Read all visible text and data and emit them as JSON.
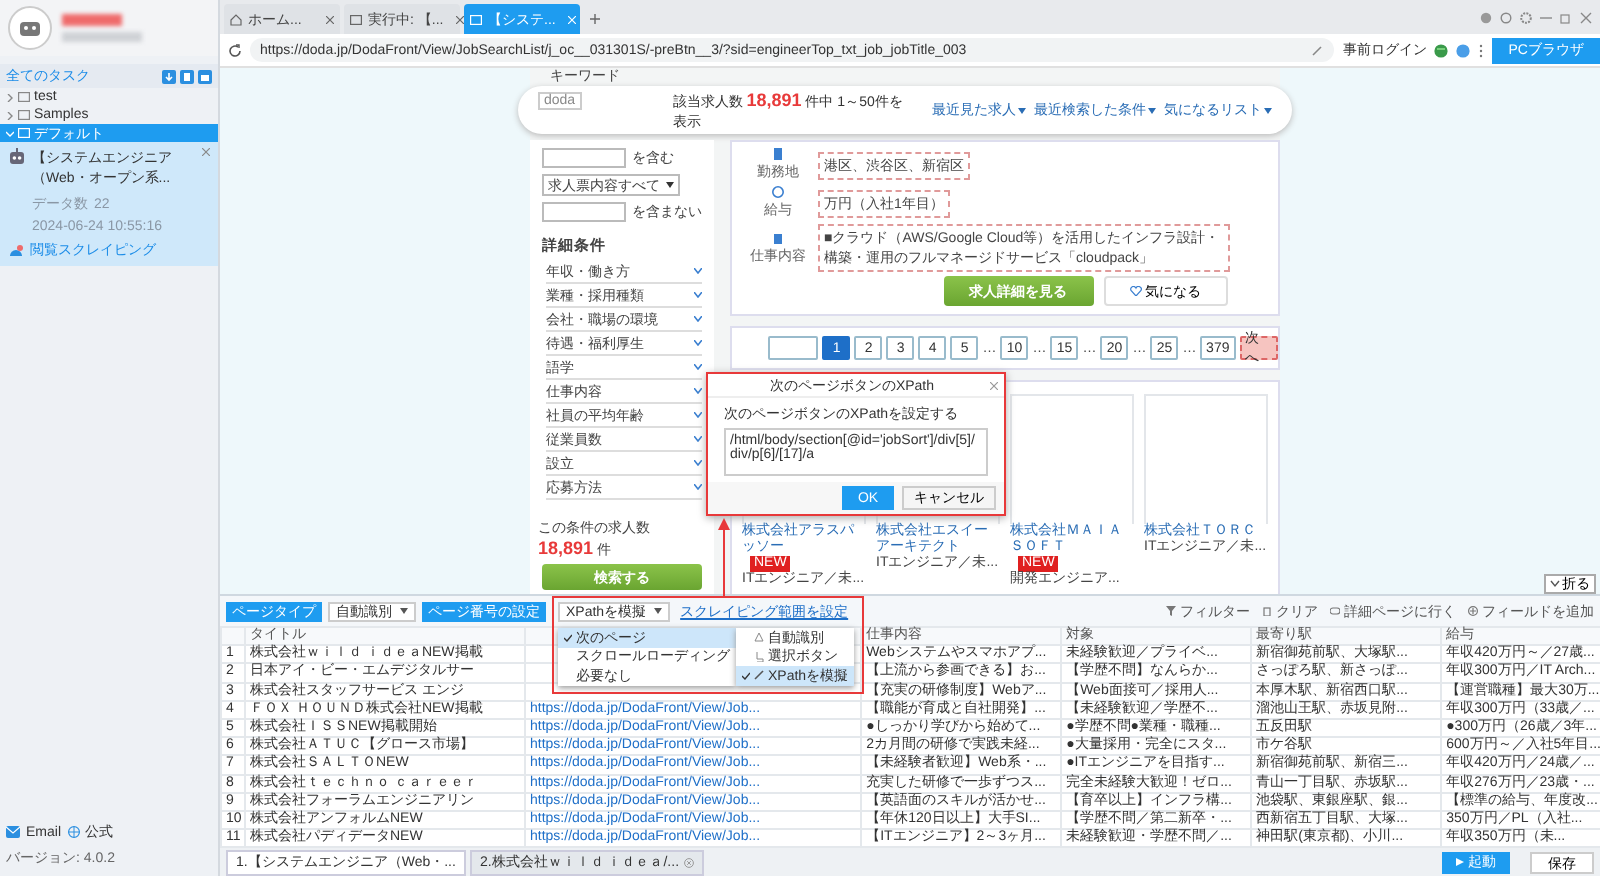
{
  "sidebar": {
    "header": "全てのタスク",
    "groups": [
      {
        "label": "test",
        "expanded": false,
        "selected": false
      },
      {
        "label": "Samples",
        "expanded": false,
        "selected": false
      },
      {
        "label": "デフォルト",
        "expanded": true,
        "selected": true
      }
    ],
    "task": {
      "title": "【システムエンジニア（Web・オープン系...",
      "data_label": "データ数",
      "data_count": "22",
      "time": "2024-06-24 10:55:16",
      "action": "閲覧スクレイピング"
    },
    "footer": {
      "links": [
        "Email",
        "公式"
      ],
      "version": "バージョン: 4.0.2"
    }
  },
  "browser": {
    "tabs": [
      {
        "label": "ホーム...",
        "selected": false
      },
      {
        "label": "実行中: 【...",
        "selected": false
      },
      {
        "label": "【システ...",
        "selected": true
      }
    ],
    "url": "https://doda.jp/DodaFront/View/JobSearchList/j_oc__031301S/-preBtn__3/?sid=engineerTop_txt_job_jobTitle_003",
    "login": "事前ログイン",
    "mode_button": "PCブラウザ"
  },
  "page": {
    "keyword_heading": "キーワード",
    "logo_alt": "doda",
    "count_prefix": "該当求人数",
    "count": "18,891",
    "count_suffix": "件中 1～50件を表示",
    "nav": [
      "最近見た求人",
      "最近検索した条件",
      "気になるリスト"
    ],
    "include": "を含む",
    "scope_select": "求人票内容すべて",
    "exclude": "を含まない",
    "details_heading": "詳細条件",
    "filters": [
      "年収・働き方",
      "業種・採用種類",
      "会社・職場の環境",
      "待遇・福利厚生",
      "語学",
      "仕事内容",
      "社員の平均年齢",
      "従業員数",
      "設立",
      "応募方法"
    ],
    "total_prefix": "この条件の求人数",
    "total": "18,891",
    "total_suffix": "件",
    "search_button": "検索する",
    "details": [
      {
        "label": "勤務地",
        "value": "港区、渋谷区、新宿区"
      },
      {
        "label": "給与",
        "value": "万円（入社1年目）"
      },
      {
        "label": "仕事内容",
        "value": "■クラウド（AWS/Google Cloud等）を活用したインフラ設計・構築・運用のフルマネージドサービス「cloudpack」"
      }
    ],
    "detail_button": "求人詳細を見る",
    "favorite_button": "気になる",
    "pagination": [
      {
        "kind": "prev",
        "selected": false
      },
      {
        "kind": "page",
        "label": "1",
        "selected": true
      },
      {
        "kind": "page",
        "label": "2",
        "selected": false
      },
      {
        "kind": "page",
        "label": "3",
        "selected": false
      },
      {
        "kind": "page",
        "label": "4",
        "selected": false
      },
      {
        "kind": "page",
        "label": "5",
        "selected": false
      },
      {
        "kind": "gap",
        "label": "…"
      },
      {
        "kind": "page",
        "label": "10",
        "selected": false
      },
      {
        "kind": "gap",
        "label": "…"
      },
      {
        "kind": "page",
        "label": "15",
        "selected": false
      },
      {
        "kind": "gap",
        "label": "…"
      },
      {
        "kind": "page",
        "label": "20",
        "selected": false
      },
      {
        "kind": "gap",
        "label": "…"
      },
      {
        "kind": "page",
        "label": "25",
        "selected": false
      },
      {
        "kind": "gap",
        "label": "…"
      },
      {
        "kind": "page",
        "label": "379",
        "selected": false
      },
      {
        "kind": "next",
        "label": "次へ",
        "selected": false
      }
    ],
    "cards": [
      {
        "company": "株式会社アラスパッソー",
        "badge": "NEW",
        "text": "ITエンジニア／未..."
      },
      {
        "company": "株式会社エスイーアーキテクト",
        "text": "ITエンジニア／未..."
      },
      {
        "company": "株式会社ＭＡＩＡＳＯＦＴ",
        "badge": "NEW",
        "text": "開発エンジニア..."
      },
      {
        "company": "株式会社ＴＯＲＣ",
        "text": "ITエンジニア／未..."
      }
    ]
  },
  "dialog": {
    "title": "次のページボタンのXPath",
    "prompt": "次のページボタンのXPathを設定する",
    "value": "/html/body/section[@id='jobSort']/div[5]/div/p[6]/[17]/a",
    "ok": "OK",
    "cancel": "キャンセル"
  },
  "panel": {
    "collapse": "折る",
    "page_type_label": "ページタイプ",
    "page_type": "自動識別",
    "page_number_label": "ページ番号の設定",
    "page_number": "XPathを模擬",
    "range_link": "スクレイピング範囲を設定",
    "tools": [
      "フィルター",
      "クリア",
      "詳細ページに行く",
      "フィールドを追加"
    ],
    "menu": [
      {
        "label": "次のページ",
        "selected": true
      },
      {
        "label": "スクロールローディング",
        "selected": false
      },
      {
        "label": "必要なし",
        "selected": false
      }
    ],
    "submenu": [
      {
        "label": "自動識別",
        "selected": false
      },
      {
        "label": "選択ボタン",
        "selected": false
      },
      {
        "label": "XPathを模擬",
        "selected": true
      }
    ],
    "header": {
      "title": "タイトル",
      "work": "仕事内容",
      "target": "対象",
      "station": "最寄り駅",
      "salary": "給与"
    },
    "rows": [
      {
        "num": "1",
        "title": "株式会社ｗｉｌｄ ｉｄｅａNEW掲載",
        "work": "Webシステムやスマホアプ...",
        "target": "未経験歓迎／プライベ...",
        "station": "新宿御苑前駅、大塚駅...",
        "salary": "年収420万円～／27歳..."
      },
      {
        "num": "2",
        "title": "日本アイ・ビー・エムデジタルサー",
        "work": "【上流から参画できる】お...",
        "target": "【学歴不問】なんらか...",
        "station": "さっぽろ駅、新さっぽ...",
        "salary": "年収300万円／IT Arch..."
      },
      {
        "num": "3",
        "title": "株式会社スタッフサービス エンジ",
        "work": "【充実の研修制度】Webア...",
        "target": "【Web面接可／採用人...",
        "station": "本厚木駅、新宿西口駅...",
        "salary": "【運営職種】最大30万..."
      },
      {
        "num": "4",
        "title": "ＦＯＸ ＨＯＵＮＤ株式会社NEW掲載",
        "link": "https://doda.jp/DodaFront/View/Job...",
        "work": "【職能が育成と自社開発】...",
        "target": "【未経験歓迎／学歴不...",
        "station": "溜池山王駅、赤坂見附...",
        "salary": "年収300万円（33歳／..."
      },
      {
        "num": "5",
        "title": "株式会社ＩＳＳNEW掲載開始",
        "link": "https://doda.jp/DodaFront/View/Job...",
        "work": "●しっかり学びから始めて...",
        "target": "●学歴不問●業種・職種...",
        "station": "五反田駅",
        "salary": "●300万円（26歳／3年..."
      },
      {
        "num": "6",
        "title": "株式会社ＡＴＵＣ【グロース市場】",
        "link": "https://doda.jp/DodaFront/View/Job...",
        "work": "2カ月間の研修で実践未経...",
        "target": "●大量採用・完全にスタ...",
        "station": "市ケ谷駅",
        "salary": "600万円～／入社5年目..."
      },
      {
        "num": "7",
        "title": "株式会社ＳＡＬＴＯNEW",
        "link": "https://doda.jp/DodaFront/View/Job...",
        "work": "【未経験者歓迎】Web系・...",
        "target": "●ITエンジニアを目指す...",
        "station": "新宿御苑前駅、新宿三...",
        "salary": "年収420万円／24歳／..."
      },
      {
        "num": "8",
        "title": "株式会社ｔｅｃｈｎｏ ｃａｒｅｅｒ",
        "link": "https://doda.jp/DodaFront/View/Job...",
        "work": "充実した研修で一歩ずつス...",
        "target": "完全未経験大歓迎！ゼロ...",
        "station": "青山一丁目駅、赤坂駅...",
        "salary": "年収276万円／23歳・..."
      },
      {
        "num": "9",
        "title": "株式会社フォーラムエンジニアリン",
        "link": "https://doda.jp/DodaFront/View/Job...",
        "work": "【英語面のスキルが活かせ...",
        "target": "【育卒以上】インフラ構...",
        "station": "池袋駅、東銀座駅、銀...",
        "salary": "【標準の給与、年度改..."
      },
      {
        "num": "10",
        "title": "株式会社アンフォルムNEW",
        "link": "https://doda.jp/DodaFront/View/Job...",
        "work": "【年休120日以上】大手SI...",
        "target": "【学歴不問／第二新卒・...",
        "station": "西新宿五丁目駅、大塚...",
        "salary": "350万円／PL（入社..."
      },
      {
        "num": "11",
        "title": "株式会社パディデータNEW",
        "link": "https://doda.jp/DodaFront/View/Job...",
        "work": "【ITエンジニア】2～3ヶ月...",
        "target": "未経験歓迎・学歴不問／...",
        "station": "神田駅(東京都)、小川...",
        "salary": "年収350万円（未..."
      }
    ],
    "bottom_tabs": [
      {
        "label": "1.【システムエンジニア（Web・...",
        "selected": true
      },
      {
        "label": "2.株式会社ｗｉｌｄ ｉｄｅａ/...",
        "selected": false
      }
    ],
    "run_button": "起動",
    "save_button": "保存"
  }
}
